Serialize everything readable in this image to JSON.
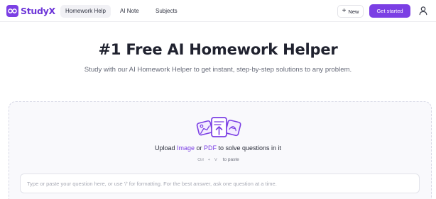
{
  "brand": {
    "name": "StudyX",
    "accent": "#7b3fe4"
  },
  "nav": {
    "items": [
      {
        "label": "Homework Help",
        "active": true
      },
      {
        "label": "AI Note",
        "active": false
      },
      {
        "label": "Subjects",
        "active": false
      }
    ]
  },
  "actions": {
    "new_label": "New",
    "get_started_label": "Get started"
  },
  "hero": {
    "title": "#1 Free AI Homework Helper",
    "subtitle": "Study with our AI Homework Helper to get instant, step-by-step solutions to any problem."
  },
  "upload": {
    "prefix": "Upload ",
    "image_link": "Image",
    "or": " or ",
    "pdf_link": "PDF",
    "suffix": " to solve questions in it",
    "shortcut_key1": "Ctrl",
    "shortcut_plus": "+",
    "shortcut_key2": "V",
    "shortcut_label": "to paste"
  },
  "question": {
    "placeholder": "Type or paste your question here, or use '/' for formatting. For the best answer, ask one question at a time.",
    "value": ""
  },
  "icons": {
    "logo": "studyx-logo-icon",
    "new": "plus-icon",
    "user": "user-icon",
    "upload": "upload-illustration-icon"
  }
}
